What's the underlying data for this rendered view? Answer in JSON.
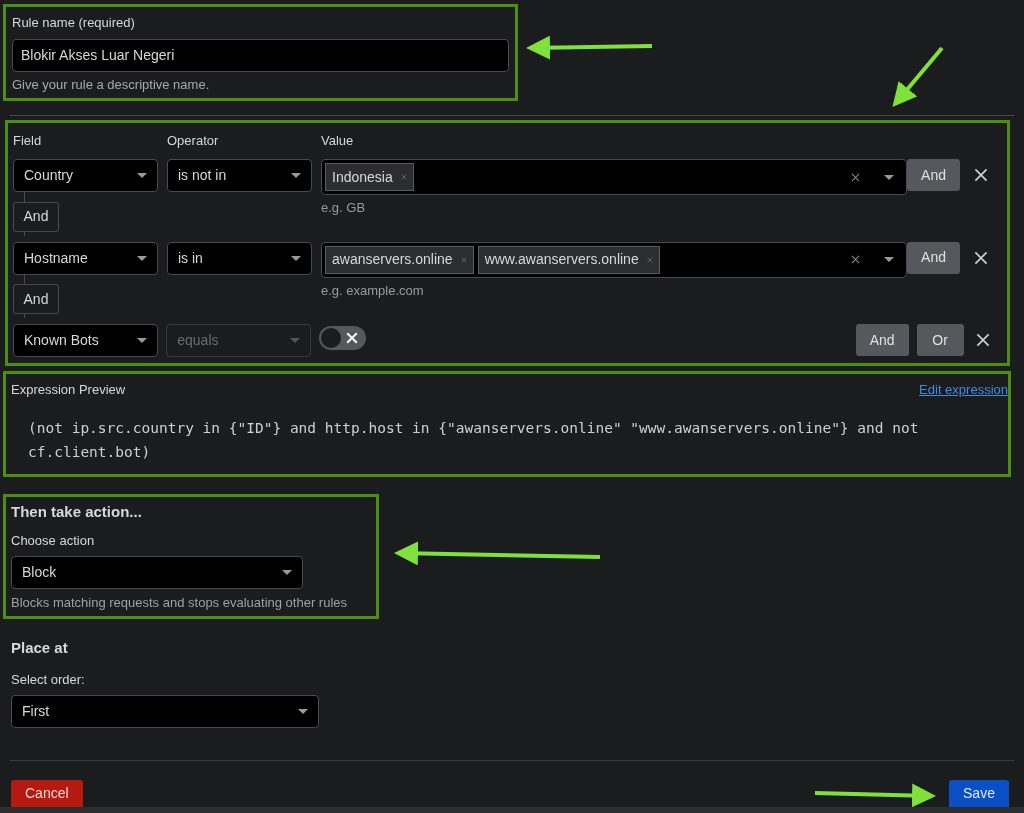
{
  "rule_name": {
    "label": "Rule name (required)",
    "value": "Blokir Akses Luar Negeri",
    "hint": "Give your rule a descriptive name."
  },
  "conditions": {
    "headers": [
      "Field",
      "Operator",
      "Value"
    ],
    "rows": [
      {
        "field": "Country",
        "operator": "is not in",
        "operator_disabled": false,
        "kind": "tags",
        "tags": [
          "Indonesia"
        ],
        "hint": "e.g. GB",
        "buttons": [
          "And"
        ]
      },
      {
        "field": "Hostname",
        "operator": "is in",
        "operator_disabled": false,
        "kind": "tags",
        "tags": [
          "awanservers.online",
          "www.awanservers.online"
        ],
        "hint": "e.g. example.com",
        "buttons": [
          "And"
        ]
      },
      {
        "field": "Known Bots",
        "operator": "equals",
        "operator_disabled": true,
        "kind": "toggle",
        "on": false,
        "buttons": [
          "And",
          "Or"
        ]
      }
    ],
    "connectors": [
      "And",
      "And"
    ]
  },
  "expression": {
    "title": "Expression Preview",
    "link": "Edit expression",
    "code": "(not ip.src.country in {\"ID\"} and http.host in {\"awanservers.online\" \"www.awanservers.online\"} and not cf.client.bot)"
  },
  "action": {
    "title": "Then take action...",
    "label": "Choose action",
    "value": "Block",
    "hint": "Blocks matching requests and stops evaluating other rules"
  },
  "place": {
    "title": "Place at",
    "label": "Select order:",
    "value": "First"
  },
  "footer": {
    "cancel": "Cancel",
    "save": "Save"
  }
}
